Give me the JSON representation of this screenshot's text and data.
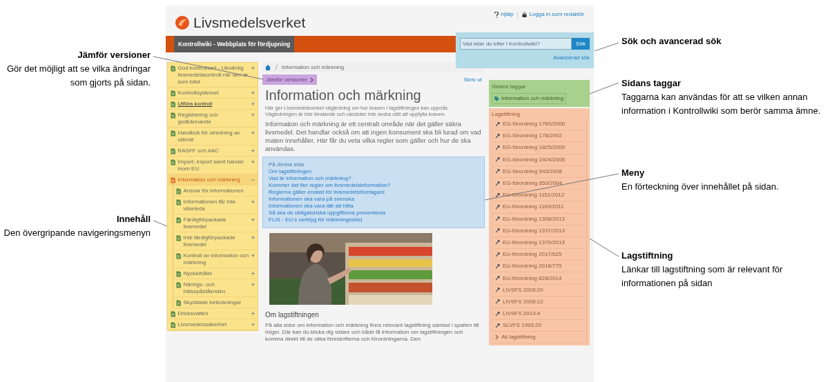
{
  "annotations_left": [
    {
      "title": "Jämför versioner",
      "text": "Gör det möjligt att se vilka ändringar som gjorts på sidan."
    },
    {
      "title": "Innehåll",
      "text": "Den övergripande navigeringsmenyn"
    }
  ],
  "annotations_right": [
    {
      "title": "Sök och avancerad sök"
    },
    {
      "title": "Sidans taggar",
      "text": "Taggarna kan användas för att se vilken annan information i Kontrollwiki som berör samma ämne."
    },
    {
      "title": "Meny",
      "text": "En förteckning över innehållet på sidan."
    },
    {
      "title": "Lagstiftning",
      "text": "Länkar till lagstiftning som är relevant för informationen på sidan"
    }
  ],
  "header": {
    "logo": "Livsmedelsverket",
    "help": "Hjälp",
    "login": "Logga in som redaktör",
    "site_title": "Kontrollwiki - Webbplats för fördjupning",
    "search": {
      "placeholder": "Vad letar du efter i Kontrollwiki?",
      "button": "Sök",
      "advanced": "Avancerad sök"
    }
  },
  "sidebar": {
    "items": [
      {
        "label": "God kontrollsed - Likvärdig livsmedelskontroll när den är som bäst",
        "toggle": "+",
        "selected": false,
        "hovered": false
      },
      {
        "label": "Kontrollsystemet",
        "toggle": "+",
        "selected": false,
        "hovered": false
      },
      {
        "label": "Utföra kontroll",
        "toggle": "+",
        "selected": false,
        "hovered": true
      },
      {
        "label": "Registrering och godkännande",
        "toggle": "+",
        "selected": false,
        "hovered": false
      },
      {
        "label": "Handbok för utredning av utbrott",
        "toggle": "+",
        "selected": false,
        "hovered": false
      },
      {
        "label": "RASFF och AAC",
        "toggle": "+",
        "selected": false,
        "hovered": false
      },
      {
        "label": "Import, export samt handel inom EU",
        "toggle": "+",
        "selected": false,
        "hovered": false
      },
      {
        "label": "Information och märkning",
        "toggle": "−",
        "selected": true,
        "hovered": false,
        "children": [
          {
            "label": "Ansvar för informationen",
            "selected": false,
            "hovered": false
          },
          {
            "label": "Informationen får inte vilseleda",
            "toggle": "+",
            "selected": false,
            "hovered": false
          },
          {
            "label": "Färdigförpackade livsmedel",
            "toggle": "+",
            "selected": false,
            "hovered": false
          },
          {
            "label": "Inte färdigförpackade livsmedel",
            "toggle": "+",
            "selected": false,
            "hovered": false
          },
          {
            "label": "Kontroll av information och märkning",
            "toggle": "+",
            "selected": false,
            "hovered": false
          },
          {
            "label": "Nyckelhålet",
            "toggle": "+",
            "selected": false,
            "hovered": false
          },
          {
            "label": "Närings- och hälsopåståenden",
            "toggle": "+",
            "selected": false,
            "hovered": false
          },
          {
            "label": "Skyddade beteckningar",
            "selected": false,
            "hovered": false
          }
        ]
      },
      {
        "label": "Dricksvatten",
        "toggle": "+",
        "selected": false,
        "hovered": false
      },
      {
        "label": "Livsmedelssäkerhet",
        "toggle": "+",
        "selected": false,
        "hovered": false
      }
    ]
  },
  "main": {
    "breadcrumb": "Information och märkning",
    "compare": "Jämför versioner",
    "print": "Skriv ut",
    "title": "Information och märkning",
    "disclaimer": "Här ger Livsmedelsverket vägledning om hur kraven i lagstiftningen kan uppnås. Vägledningen är inte bindande och utesluter inte andra sätt att uppfylla kraven.",
    "lead": "Information och märkning är ett centralt område när det gäller säkra livsmedel. Det handlar också om att ingen konsument ska bli lurad om vad maten innehåller. Här får du veta vilka regler som gäller och hur de ska användas.",
    "toc": {
      "heading": "På denna sida",
      "links": [
        "Om lagstiftningen",
        "Vad är information och märkning?",
        "Kommer det fler regler om livsmedelsinformation?",
        "Reglerna gäller endast för livsmedelsföretagare",
        "Informationen ska vara på svenska",
        "Informationen ska vara lätt att hitta",
        "Så ska de obligatoriska uppgifterna presenteras",
        "FLIS - EU:s verktyg för märkningsstöd"
      ]
    },
    "section_title": "Om lagstiftningen",
    "section_text": "På alla sidor om information och märkning finns relevant lagstiftning samlad i spalten till höger. Där kan du klicka dig vidare och både få information om lagstiftningen och komma direkt till de olika föreskrifterna och förordningarna. Den"
  },
  "tags": {
    "heading": "Sidans taggar",
    "items": [
      "Information och märkning"
    ]
  },
  "legislation": {
    "heading": "Lagstiftning",
    "items": [
      "EG-förordning 1760/2000",
      "EG-förordning 178/2002",
      "EG-förordning 1825/2000",
      "EG-förordning 1924/2006",
      "EG-förordning 543/2008",
      "EG-förordning 853/2004",
      "EU-förordning 1151/2012",
      "EU-förordning 1169/2011",
      "EU-förordning 1308/2013",
      "EU-förordning 1337/2013",
      "EU-förordning 1379/2013",
      "EU-förordning 2017/625",
      "EU-förordning 2018/775",
      "EU-förordning 828/2014",
      "LIVSFS 2005:20",
      "LIVSFS 2006:12",
      "LIVSFS 2014:4",
      "SLVFS 1993:20"
    ],
    "all": "All lagstiftning"
  }
}
